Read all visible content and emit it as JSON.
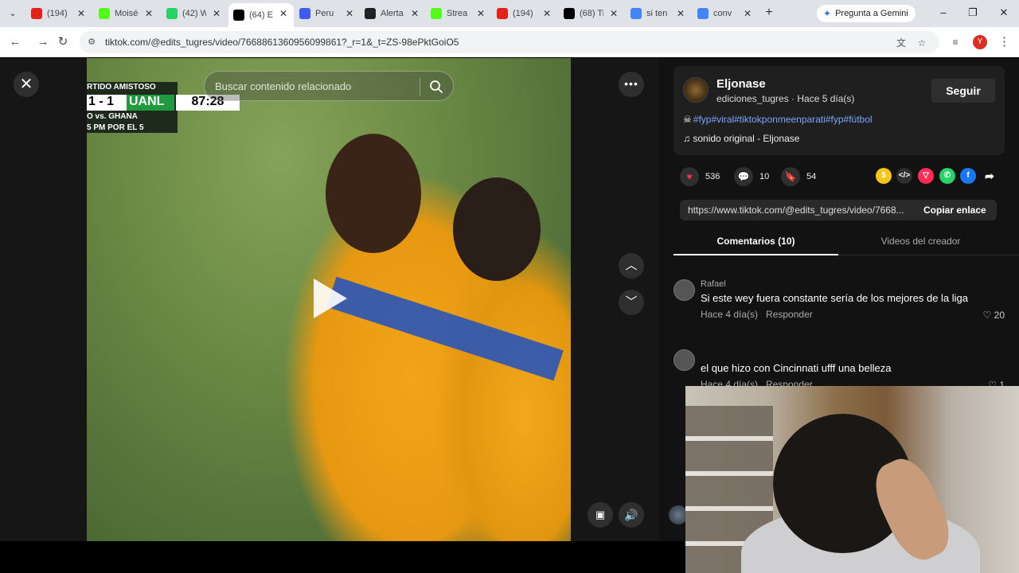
{
  "browser": {
    "tabs": [
      {
        "title": "(194)",
        "favicon": "youtube-icon",
        "color": "#e62117",
        "active": false
      },
      {
        "title": "Moisé",
        "favicon": "kick-icon",
        "color": "#53fc18",
        "active": false
      },
      {
        "title": "(42) W",
        "favicon": "whatsapp-icon",
        "color": "#25d366",
        "active": false
      },
      {
        "title": "(64) E",
        "favicon": "tiktok-icon",
        "color": "#000000",
        "active": true
      },
      {
        "title": "Peru",
        "favicon": "doc-icon",
        "color": "#3c5cf0",
        "active": false
      },
      {
        "title": "Alerta",
        "favicon": "alert-icon",
        "color": "#222222",
        "active": false
      },
      {
        "title": "Strea",
        "favicon": "kick-icon",
        "color": "#53fc18",
        "active": false
      },
      {
        "title": "(194)",
        "favicon": "youtube-icon",
        "color": "#e62117",
        "active": false
      },
      {
        "title": "(68) Ti",
        "favicon": "tiktok-icon",
        "color": "#000000",
        "active": false
      },
      {
        "title": "si ten",
        "favicon": "google-icon",
        "color": "#4285f4",
        "active": false
      },
      {
        "title": "conv",
        "favicon": "google-icon",
        "color": "#4285f4",
        "active": false
      }
    ],
    "gemini_label": "Pregunta a Gemini",
    "url": "tiktok.com/@edits_tugres/video/7668861360956099861?_r=1&_t=ZS-98ePktGoiO5",
    "profile_initial": "Y"
  },
  "video": {
    "search_placeholder": "Buscar contenido relacionado",
    "scoreboard": {
      "header": "RTIDO AMISTOSO",
      "score": "1 - 1",
      "team": "UANL",
      "clock": "87:28",
      "line1": "O vs. GHANA",
      "line2": "5 PM POR EL 5"
    }
  },
  "creator": {
    "name": "Eljonase",
    "handle_line": "ediciones_tugres · Hace 5 día(s)",
    "follow_label": "Seguir",
    "caption": "#fyp#viral#tiktokponmeenparati#fyp#fútbol",
    "sound": "sonido original - Eljonase"
  },
  "stats": {
    "likes": "536",
    "comments": "10",
    "saves": "54"
  },
  "link": {
    "url": "https://www.tiktok.com/@edits_tugres/video/7668...",
    "copy_label": "Copiar enlace"
  },
  "tabs": {
    "comments_label": "Comentarios (10)",
    "creator_videos_label": "Videos del creador"
  },
  "comments": [
    {
      "user": "Rafael",
      "text": "Si este wey fuera constante sería de los mejores de la liga",
      "time": "Hace 4 día(s)",
      "reply": "Responder",
      "likes": "20"
    },
    {
      "user": "",
      "text": "el que hizo con Cincinnati ufff una belleza",
      "time": "Hace 4 día(s)",
      "reply": "Responder",
      "likes": "1"
    }
  ],
  "share_colors": {
    "coin": "#f5c518",
    "embed": "#2f2f2f",
    "repost": "#fe2c55",
    "whatsapp": "#25d366",
    "facebook": "#1877f2"
  }
}
